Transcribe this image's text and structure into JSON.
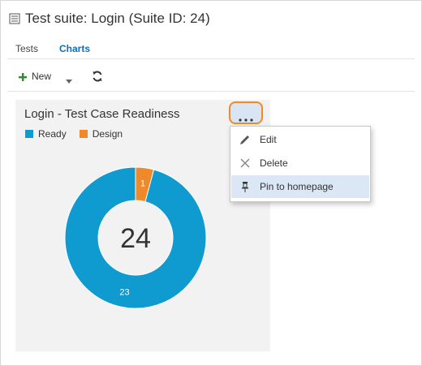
{
  "header": {
    "title": "Test suite: Login (Suite ID: 24)",
    "icon": "test-suite-icon"
  },
  "tabs": [
    {
      "label": "Tests",
      "active": false
    },
    {
      "label": "Charts",
      "active": true
    }
  ],
  "toolbar": {
    "new_label": "New",
    "new_icon": "plus-icon",
    "refresh_icon": "refresh-icon"
  },
  "chart": {
    "title": "Login - Test Case Readiness",
    "more_icon": "ellipsis-icon",
    "center_total": "24"
  },
  "chart_data": {
    "type": "pie",
    "title": "Login - Test Case Readiness",
    "donut": true,
    "center_label": "24",
    "legend_position": "top-left",
    "series": [
      {
        "name": "Ready",
        "value": 23,
        "color": "#0f9bd0"
      },
      {
        "name": "Design",
        "value": 1,
        "color": "#f0892a"
      }
    ]
  },
  "context_menu": {
    "items": [
      {
        "label": "Edit",
        "icon": "pencil-icon"
      },
      {
        "label": "Delete",
        "icon": "close-icon"
      },
      {
        "label": "Pin to homepage",
        "icon": "pin-icon",
        "highlighted": true
      }
    ]
  },
  "colors": {
    "accent": "#106ebe",
    "highlight_border": "#f28a22",
    "menu_highlight": "#dce7f5",
    "add_green": "#2e8b2e"
  }
}
